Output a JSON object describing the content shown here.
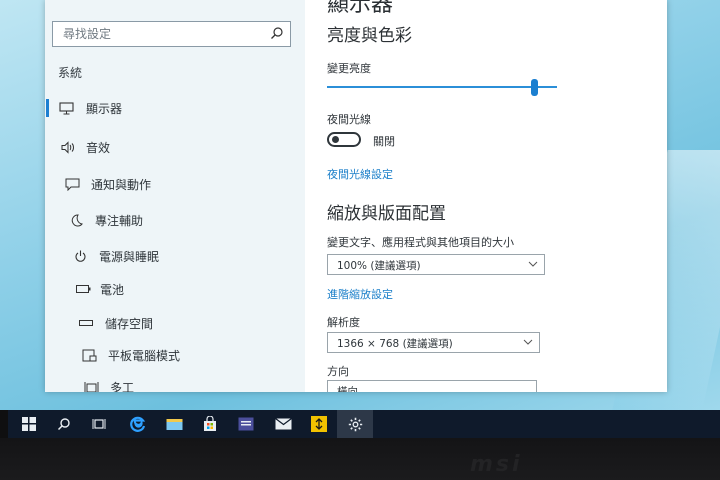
{
  "search": {
    "placeholder": "尋找設定"
  },
  "nav": {
    "heading": "系統",
    "items": [
      {
        "label": "顯示器",
        "icon": "monitor-icon",
        "active": true
      },
      {
        "label": "音效",
        "icon": "speaker-icon"
      },
      {
        "label": "通知與動作",
        "icon": "notification-icon"
      },
      {
        "label": "專注輔助",
        "icon": "moon-icon"
      },
      {
        "label": "電源與睡眠",
        "icon": "power-icon"
      },
      {
        "label": "電池",
        "icon": "battery-icon"
      },
      {
        "label": "儲存空間",
        "icon": "storage-icon"
      },
      {
        "label": "平板電腦模式",
        "icon": "tablet-icon"
      },
      {
        "label": "多工",
        "icon": "multitask-icon"
      }
    ]
  },
  "main": {
    "page_title": "顯示器",
    "brightness_section": "亮度與色彩",
    "brightness_label": "變更亮度",
    "brightness_value": 0.9,
    "night_light_label": "夜間光線",
    "night_light_state": "關閉",
    "night_light_settings_link": "夜間光線設定",
    "scale_section": "縮放與版面配置",
    "scale_label": "變更文字、應用程式與其他項目的大小",
    "scale_value": "100% (建議選項)",
    "advanced_scaling_link": "進階縮放設定",
    "resolution_label": "解析度",
    "resolution_value": "1366 × 768 (建議選項)",
    "orientation_label": "方向",
    "orientation_value": "橫向"
  },
  "taskbar": {
    "buttons": [
      "start-icon",
      "search-icon",
      "task-view-icon",
      "edge-icon",
      "file-explorer-icon",
      "store-icon",
      "app-icon",
      "mail-icon",
      "app-yellow-icon",
      "settings-icon"
    ]
  },
  "bezel": {
    "brand": "msi"
  },
  "colors": {
    "accent": "#1b7fd0",
    "taskbar": "#0f1a2b",
    "link": "#1b7fc9"
  }
}
